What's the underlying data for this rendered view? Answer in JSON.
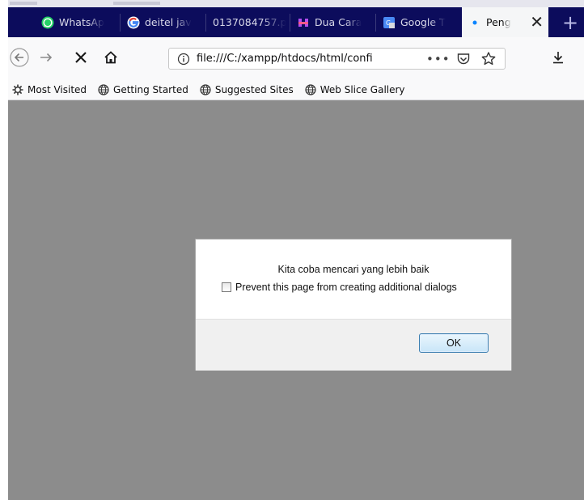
{
  "window": {
    "colors": {
      "tabbar_bg": "#0c0c5c",
      "content_bg": "#8c8c8c",
      "toolbar_bg": "#f9f9fa",
      "active_dot": "#0a84ff"
    }
  },
  "tabs": [
    {
      "label": "WhatsAp",
      "icon": "whatsapp-icon"
    },
    {
      "label": "deitel jav",
      "icon": "google-icon"
    },
    {
      "label": "0137084757.p",
      "icon": ""
    },
    {
      "label": "Dua Cara",
      "icon": "site-icon"
    },
    {
      "label": "Google T",
      "icon": "google-translate-icon"
    },
    {
      "label": "Peng",
      "icon": "loading-dot-icon",
      "active": true
    }
  ],
  "navbar": {
    "url": "file:///C:/xampp/htdocs/html/confi",
    "more_label": "•••"
  },
  "bookmarks": [
    {
      "label": "Most Visited",
      "icon": "gear-icon"
    },
    {
      "label": "Getting Started",
      "icon": "globe-icon"
    },
    {
      "label": "Suggested Sites",
      "icon": "globe-icon"
    },
    {
      "label": "Web Slice Gallery",
      "icon": "globe-icon"
    }
  ],
  "dialog": {
    "message": "Kita coba mencari yang lebih baik",
    "checkbox_label": "Prevent this page from creating additional dialogs",
    "checkbox_checked": false,
    "ok_label": "OK"
  }
}
